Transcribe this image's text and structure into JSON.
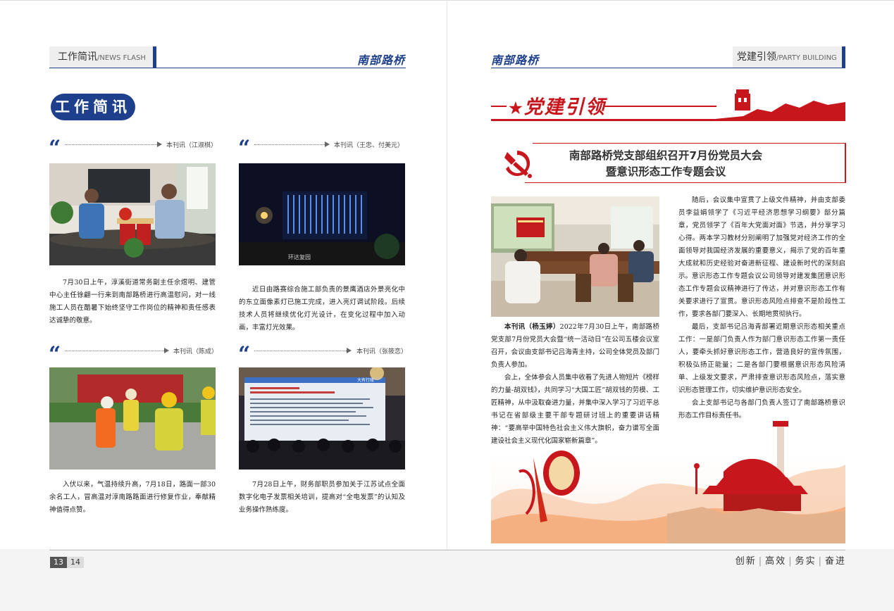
{
  "header": {
    "left_tab_cn": "工作简讯",
    "left_tab_sep": "/",
    "left_tab_en": "NEWS FLASH",
    "brand": "南部路桥",
    "right_tab_cn": "党建引领",
    "right_tab_sep": "/",
    "right_tab_en": "PARTY BUILDING"
  },
  "left_page": {
    "section_title": "工作简讯",
    "items": [
      {
        "quote": "“",
        "byline": "本刊讯（江淑棋）",
        "text": "7月30日上午，淳溪街道常务副主任佘煜明、建管中心主任徐翩一行来到南部路桥进行高温慰问，对一线施工人员在酷暑下始终坚守工作岗位的精神和责任感表达诚挚的敬意。"
      },
      {
        "quote": "“",
        "byline": "本刊讯（王忠、付美元）",
        "text": "近日由路赛综合施工部负责的景鹰酒店外景亮化中的东立面像素灯已施工完成，进入亮灯调试阶段。后续技术人员将继续优化灯光设计，在变化过程中加入动画，丰富灯光效果。",
        "photo_sign": "环达复园"
      },
      {
        "quote": "“",
        "byline": "本刊讯（陈成）",
        "text": "入伏以来，气温持续升高，7月18日，路面一部30余名工人，冒高温对淳南路路面进行修复作业，奉献精神值得点赞。"
      },
      {
        "quote": "“",
        "byline": "本刊讯（张筱恋）",
        "text": "7月28日上午，财务部职员参加关于江苏试点全面数字化电子发票相关培训，提高对“全电发票”的认知及业务操作熟练度。",
        "screen_brand": "大有行账"
      }
    ]
  },
  "right_page": {
    "banner_title": "党建引领",
    "headline_line1": "南部路桥党支部组织召开7月份党员大会",
    "headline_line2": "暨意识形态工作专题会议",
    "article_lead_label": "本刊讯（杨玉婷）",
    "article_col1_p1_rest": "2022年7月30日上午，南部路桥党支部7月份党员大会暨“统一活动日”在公司五楼会议室召开，会议由支部书记吕海青主持，公司全体党员及部门负责人参加。",
    "article_col1_p2": "会上，全体参会人员集中收看了先进人物短片《榜样的力量-胡双钱》，共同学习“大国工匠”胡双钱的劳模、工匠精神，从中汲取奋进力量，并集中深入学习了习近平总书记在省部级主要干部专题研讨班上的重要讲话精神：“要高举中国特色社会主义伟大旗帜，奋力谱写全面建设社会主义现代化国家崭新篇章”。",
    "article_col2_p1": "随后，会议集中宣贯了上级文件精神，并由支部委员李益娟领学了《习近平经济思想学习纲要》部分篇章，党员领学了《百年大党面对面》节选，并分享学习心得。两本学习教材分别阐明了加强党对经济工作的全面领导对我国经济发展的重要意义，揭示了党的百年重大成就和历史经验对奋进新征程、建设新时代的深刻启示。",
    "article_col2_p2": "意识形态工作专题会议公司领导对建发集团意识形态工作专题会议精神进行了传达，并对意识形态工作有关要求进行了宣贯。意识形态风险点排查不是阶段性工作，要求各部门要深入、长期地贯彻执行。",
    "article_col2_p3": "最后，支部书记吕海青部署近期意识形态相关重点工作：一是部门负责人作为部门意识形态工作第一责任人，要牵头抓好意识形态工作，营造良好的宣传氛围，积极弘扬正能量；二是各部门要根据意识形态风险清单、上级发文要求，严肃排查意识形态风险点，落实意识形态管理工作，切实维护意识形态安全。",
    "article_col2_p4": "会上支部书记与各部门负责人签订了南部路桥意识形态工作目标责任书。"
  },
  "footer": {
    "page_left": "13",
    "page_right": "14",
    "slogan": [
      "创新",
      "高效",
      "务实",
      "奋进"
    ],
    "slogan_sep": "|"
  },
  "colors": {
    "brand_blue": "#1d3f8c",
    "party_red": "#c8161d"
  }
}
